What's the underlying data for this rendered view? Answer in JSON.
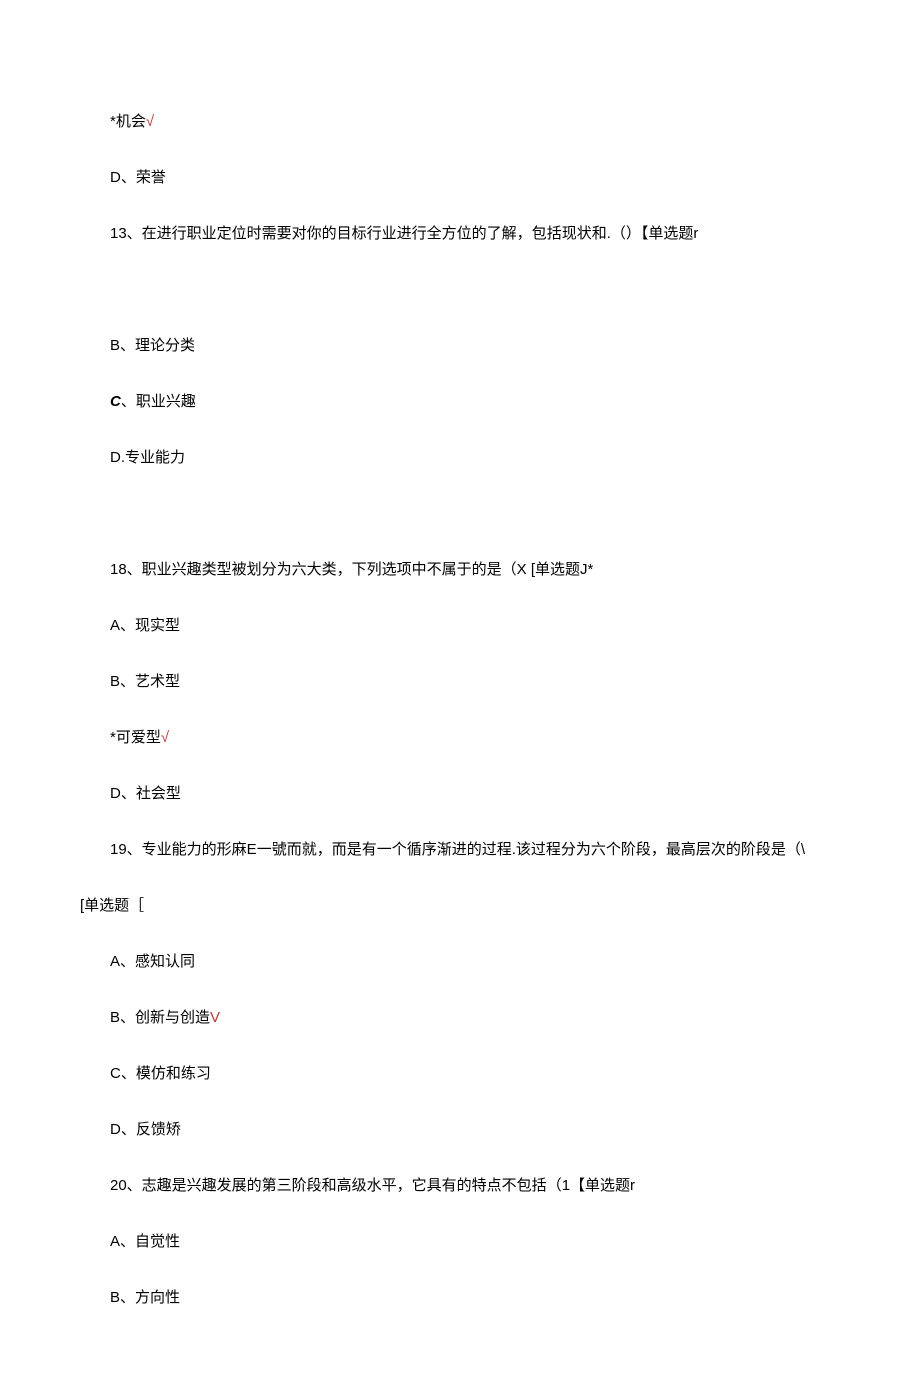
{
  "lines": [
    {
      "prefix": "*机会",
      "suffix": "√",
      "suffixRed": true,
      "indent": true
    },
    {
      "text": "D、荣誉",
      "indent": true
    },
    {
      "text": "13、在进行职业定位时需要对你的目标行业进行全方位的了解，包括现状和.（）【单选题r",
      "indent": true
    },
    {
      "text": "",
      "indent": true
    },
    {
      "text": "B、理论分类",
      "indent": true
    },
    {
      "c_label": "C",
      "c_rest": "、职业兴趣",
      "indent": true
    },
    {
      "text": "D.专业能力",
      "indent": true
    },
    {
      "text": "",
      "indent": true
    },
    {
      "text": "18、职业兴趣类型被划分为六大类，下列选项中不属于的是（X  [单选题J*",
      "indent": true
    },
    {
      "text": "A、现实型",
      "indent": true
    },
    {
      "text": "B、艺术型",
      "indent": true
    },
    {
      "prefix": "*可爱型",
      "suffix": "√",
      "suffixRed": true,
      "indent": true
    },
    {
      "text": "D、社会型",
      "indent": true
    },
    {
      "text": "19、专业能力的形麻E一號而就，而是有一个循序渐进的过程.该过程分为六个阶段，最高层次的阶段是（\\",
      "indent": true
    },
    {
      "text": "[单选题［",
      "indent": false
    },
    {
      "text": "A、感知认同",
      "indent": true
    },
    {
      "prefix": "B、创新与创造",
      "suffix": "V",
      "suffixRed": true,
      "indent": true
    },
    {
      "text": "C、模仿和练习",
      "indent": true
    },
    {
      "text": "D、反馈矫",
      "indent": true
    },
    {
      "text": "20、志趣是兴趣发展的第三阶段和高级水平，它具有的特点不包括（1【单选题r",
      "indent": true
    },
    {
      "text": "A、自觉性",
      "indent": true
    },
    {
      "text": "B、方向性",
      "indent": true
    }
  ]
}
